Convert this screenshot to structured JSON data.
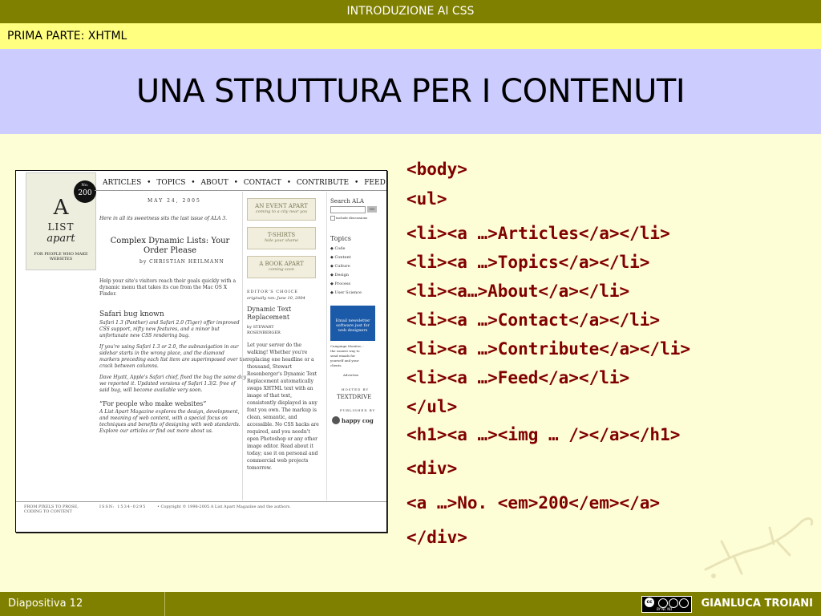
{
  "header": {
    "topbar_title": "INTRODUZIONE AI CSS",
    "section": "PRIMA PARTE: XHTML",
    "slide_title": "UNA STRUTTURA PER I CONTENUTI"
  },
  "code_lines": [
    "<body>",
    "<ul>",
    "<li><a …>Articles</a></li>",
    "<li><a …>Topics</a></li>",
    "<li><a…>About</a></li>",
    "<li><a …>Contact</a></li>",
    "<li><a …>Contribute</a></li>",
    "<li><a …>Feed</a></li>",
    "</ul>",
    "<h1><a …><img … /></a></h1>",
    "<div>",
    "<a …>No. <em>200</em></a>",
    "</div>"
  ],
  "screenshot": {
    "logo": {
      "big": "A",
      "list": "LIST",
      "apart": "apart",
      "tagline": "FOR PEOPLE WHO MAKE WEBSITES"
    },
    "badge": {
      "no": "No.",
      "num": "200"
    },
    "nav": [
      "ARTICLES",
      "•",
      "TOPICS",
      "•",
      "ABOUT",
      "•",
      "CONTACT",
      "•",
      "CONTRIBUTE",
      "•",
      "FEED"
    ],
    "date": "MAY 24, 2005",
    "intro": "Here in all its sweetness sits the last issue of ALA 3.",
    "article_title_1": "Complex Dynamic Lists: Your",
    "article_title_2": "Order Please",
    "byline": "by CHRISTIAN HEILMANN",
    "summary_1": "Help your site's visitors reach their goals quickly with a",
    "summary_2": "dynamic menu that takes its cue from the Mac OS X",
    "summary_3": "Finder.",
    "safari_title": "Safari bug known",
    "safari_1": "Safari 1.3 (Panther) and Safari 2.0 (Tiger) offer improved",
    "safari_2": "CSS support, nifty new features, and a minor but",
    "safari_3": "unfortunate new CSS rendering bug.",
    "safari_4": "If you're using Safari 1.3 or 2.0, the subnavigation in our",
    "safari_5": "sidebar starts in the wrong place, and the diamond",
    "safari_6": "markers preceding each list item are superimposed over the",
    "safari_7": "crack between columns.",
    "safari_8": "Dave Hyatt, Apple's Safari chief, fixed the bug the same day",
    "safari_9": "we reported it. Updated versions of Safari 1.3/2. free of",
    "safari_10": "said bug, will become available very soon.",
    "people_title": "“For people who make websites”",
    "people_1": "A List Apart Magazine explores the design, development,",
    "people_2": "and meaning of web content, with a special focus on",
    "people_3": "techniques and benefits of designing with web standards.",
    "people_4": "Explore our articles or find out more about us.",
    "event_1": "AN EVENT APART",
    "event_2": "coming to a city near you",
    "tshirts_1": "T-SHIRTS",
    "tshirts_2": "hide your shame",
    "book_1": "A BOOK APART",
    "book_2": "coming soon",
    "editors_choice": "EDITOR'S CHOICE",
    "originally": "originally ran: June 10, 2004",
    "dt_title_1": "Dynamic Text",
    "dt_title_2": "Replacement",
    "dt_by": "by STEWART",
    "dt_by2": "ROSENBERGER",
    "dt_1": "Let your server do the",
    "dt_2": "walking! Whether you're",
    "dt_3": "replacing one headline or a",
    "dt_4": "thousand, Stewart",
    "dt_5": "Rosenberger's Dynamic Text",
    "dt_6": "Replacement automatically",
    "dt_7": "swaps XHTML text with an",
    "dt_8": "image of that text,",
    "dt_9": "consistently displayed in any",
    "dt_10": "font you own. The markup is",
    "dt_11": "clean, semantic, and",
    "dt_12": "accessible. No CSS hacks are",
    "dt_13": "required, and you needn't",
    "dt_14": "open Photoshop or any other",
    "dt_15": "image editor. Read about it",
    "dt_16": "today; use it on personal and",
    "dt_17": "commercial web projects",
    "dt_18": "tomorrow.",
    "search_label": "Search ALA",
    "go": "GO",
    "include": "include discussions",
    "topics_title": "Topics",
    "topics": [
      "Code",
      "Content",
      "Culture",
      "Design",
      "Process",
      "User Science"
    ],
    "ad_1": "Email newsletter",
    "ad_2": "software just for",
    "ad_3": "web designers",
    "cm_1": "Campaign Monitor, -",
    "cm_2": "the easiest way to",
    "cm_3": "send emails for",
    "cm_4": "yourself and your",
    "cm_5": "clients.",
    "advertise": "Advertise",
    "hosted": "HOSTED BY",
    "textdrive": "TEXTDRIVE",
    "published": "PUBLISHED BY",
    "happycog": "happy cog",
    "bottom_left_1": "FROM PIXELS TO PROSE,",
    "bottom_left_2": "CODING TO CONTENT",
    "issn": "ISSN: 1534-0295",
    "copyright": "•  Copyright © 1998-2005 A List Apart Magazine and the authors."
  },
  "footer": {
    "slide_number": "Diapositiva 12",
    "author": "GIANLUCA TROIANI",
    "cc_top": "cc",
    "cc_bottom": "BY  NC  ND"
  },
  "colors": {
    "olive": "#808000",
    "yellow_bar": "#ffff80",
    "lavender": "#ccccff",
    "background": "#fefed6",
    "code": "#800000"
  }
}
